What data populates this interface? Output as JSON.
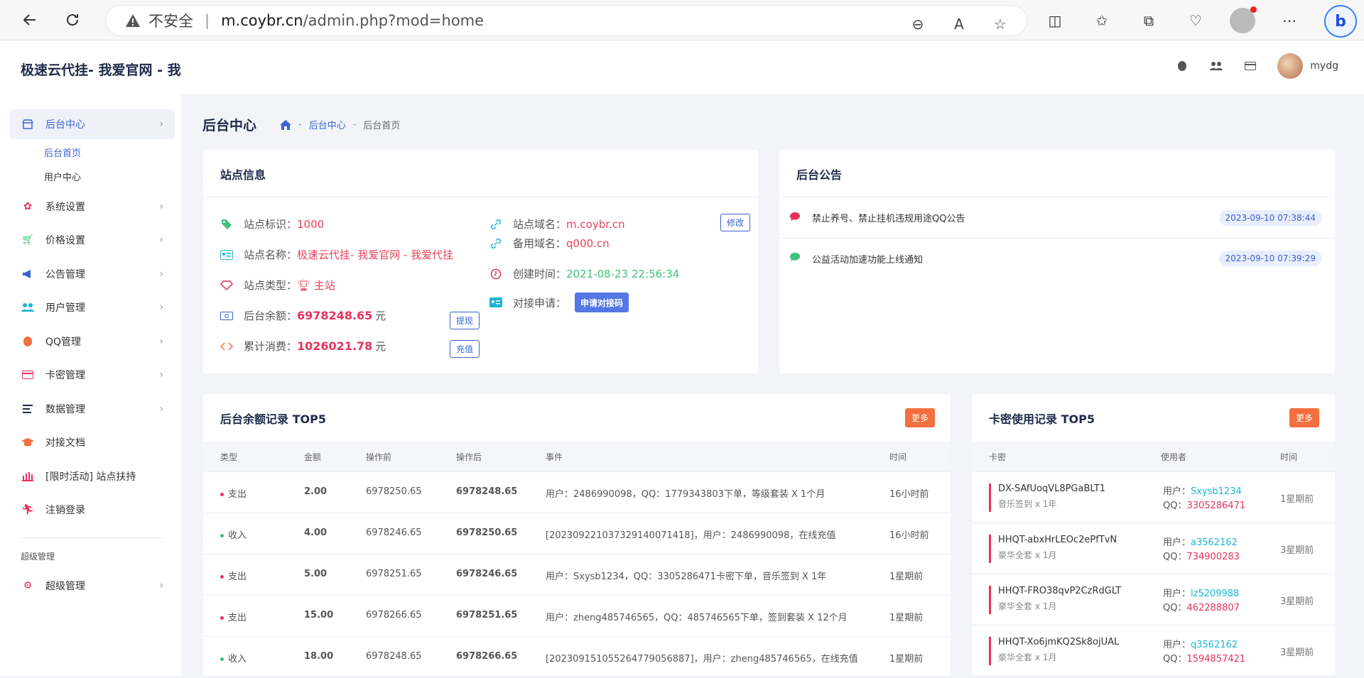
{
  "browser": {
    "insecure_label": "不安全",
    "url_host": "m.coybr.cn",
    "url_path": "/admin.php?mod=home"
  },
  "sidebar": {
    "brand": "极速云代挂- 我爱官网 - 我爱代挂",
    "items": [
      {
        "label": "后台中心",
        "icon": "store-icon"
      },
      {
        "label": "系统设置",
        "icon": "gear-icon"
      },
      {
        "label": "价格设置",
        "icon": "cart-icon"
      },
      {
        "label": "公告管理",
        "icon": "megaphone-icon"
      },
      {
        "label": "用户管理",
        "icon": "users-icon"
      },
      {
        "label": "QQ管理",
        "icon": "penguin-icon"
      },
      {
        "label": "卡密管理",
        "icon": "card-icon"
      },
      {
        "label": "数据管理",
        "icon": "list-icon"
      },
      {
        "label": "对接文档",
        "icon": "graduation-icon"
      },
      {
        "label": "[限时活动] 站点扶持",
        "icon": "chart-icon"
      },
      {
        "label": "注销登录",
        "icon": "run-icon"
      },
      {
        "label": "超级管理",
        "icon": "gears-icon"
      }
    ],
    "submenu": [
      "后台首页",
      "用户中心"
    ],
    "section_label": "超级管理"
  },
  "topbar": {
    "username": "mydg"
  },
  "page": {
    "title": "后台中心",
    "breadcrumb": [
      "后台中心",
      "后台首页"
    ]
  },
  "site_info": {
    "title": "站点信息",
    "id_label": "站点标识：",
    "id_value": "1000",
    "name_label": "站点名称：",
    "name_value": "极速云代挂- 我爱官网 - 我爱代挂",
    "type_label": "站点类型：",
    "type_value": "主站",
    "balance_label": "后台余额：",
    "balance_value": "6978248.65",
    "balance_unit": "元",
    "spent_label": "累计消费：",
    "spent_value": "1026021.78",
    "spent_unit": "元",
    "domain_label": "站点域名：",
    "domain_value": "m.coybr.cn",
    "backup_label": "备用域名：",
    "backup_value": "q000.cn",
    "created_label": "创建时间：",
    "created_value": "2021-08-23 22:56:34",
    "dock_label": "对接申请：",
    "btn_withdraw": "提现",
    "btn_recharge": "充值",
    "btn_edit": "修改",
    "btn_dock": "申请对接码"
  },
  "notices": {
    "title": "后台公告",
    "items": [
      {
        "text": "禁止养号、禁止挂机违规用途QQ公告",
        "date": "2023-09-10 07:38:44",
        "color": "#e8325c"
      },
      {
        "text": "公益活动加速功能上线通知",
        "date": "2023-09-10 07:39:29",
        "color": "#3fc17a"
      }
    ]
  },
  "balance_log": {
    "title": "后台余额记录 TOP5",
    "more": "更多",
    "headers": [
      "类型",
      "金额",
      "操作前",
      "操作后",
      "事件",
      "时间"
    ],
    "rows": [
      {
        "type": "支出",
        "dot": "#e8325c",
        "amount": "2.00",
        "before": "6978250.65",
        "after": "6978248.65",
        "event": "用户：2486990098，QQ：1779343803下单，等级套装 X 1个月",
        "time": "16小时前"
      },
      {
        "type": "收入",
        "dot": "#3fc17a",
        "amount": "4.00",
        "before": "6978246.65",
        "after": "6978250.65",
        "event": "[20230922103732914007141​8]，用户：2486990098，在线充值",
        "time": "16小时前"
      },
      {
        "type": "支出",
        "dot": "#e8325c",
        "amount": "5.00",
        "before": "6978251.65",
        "after": "6978246.65",
        "event": "用户：Sxysb1234，QQ：3305286471卡密下单，音乐签到 X 1年",
        "time": "1星期前"
      },
      {
        "type": "支出",
        "dot": "#e8325c",
        "amount": "15.00",
        "before": "6978266.65",
        "after": "6978251.65",
        "event": "用户：zheng485746565，QQ：485746565下单，签到套装 X 12个月",
        "time": "1星期前"
      },
      {
        "type": "收入",
        "dot": "#3fc17a",
        "amount": "18.00",
        "before": "6978248.65",
        "after": "6978266.65",
        "event": "[20230915105526477905688​7]，用户：zheng485746565，在线充值",
        "time": "1星期前"
      }
    ]
  },
  "card_log": {
    "title": "卡密使用记录 TOP5",
    "more": "更多",
    "headers": [
      "卡密",
      "使用者",
      "时间"
    ],
    "user_prefix": "用户：",
    "qq_prefix": "QQ：",
    "rows": [
      {
        "code": "DX-SAfUoqVL8PGaBLT1",
        "desc": "音乐签到 x 1年",
        "user": "Sxysb1234",
        "qq": "3305286471",
        "time": "1星期前"
      },
      {
        "code": "HHQT-abxHrLEOc2ePfTvN",
        "desc": "豪华全套 x 1月",
        "user": "a3562162",
        "qq": "734900283",
        "time": "3星期前"
      },
      {
        "code": "HHQT-FRO38qvP2CzRdGLT",
        "desc": "豪华全套 x 1月",
        "user": "lz5209988",
        "qq": "462288807",
        "time": "3星期前"
      },
      {
        "code": "HHQT-Xo6jmKQ2Sk8ojUAL",
        "desc": "豪华全套 x 1月",
        "user": "q3562162",
        "qq": "1594857421",
        "time": "3星期前"
      }
    ]
  }
}
